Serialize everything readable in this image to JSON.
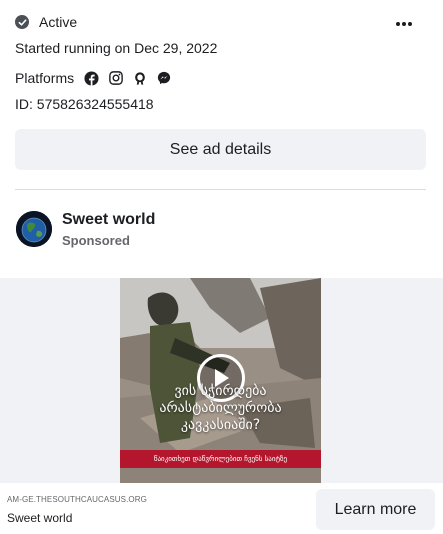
{
  "status": {
    "label": "Active",
    "icon": "check-circle-icon"
  },
  "more_menu": {
    "icon": "more-horizontal-icon"
  },
  "started": "Started running on Dec 29, 2022",
  "platforms": {
    "label": "Platforms",
    "icons": [
      "facebook-icon",
      "instagram-icon",
      "audience-network-icon",
      "messenger-icon"
    ]
  },
  "ad_id": "ID: 575826324555418",
  "see_details_label": "See ad details",
  "advertiser": {
    "name": "Sweet world",
    "sponsored": "Sponsored"
  },
  "video": {
    "title_line1": "ვის სჭირდება",
    "title_line2": "არასტაბილურობა",
    "title_line3": "კავკასიაში?",
    "banner": "წაიკითხეთ დაწვრილებით ჩვენს საიტზე",
    "play_icon": "play-icon"
  },
  "footer": {
    "domain": "AM-GE.THESOUTHCAUCASUS.ORG",
    "name": "Sweet world",
    "cta_label": "Learn more"
  },
  "colors": {
    "button_bg": "#f0f2f5",
    "banner_red": "#b3162d",
    "secondary_text": "#65676b"
  }
}
